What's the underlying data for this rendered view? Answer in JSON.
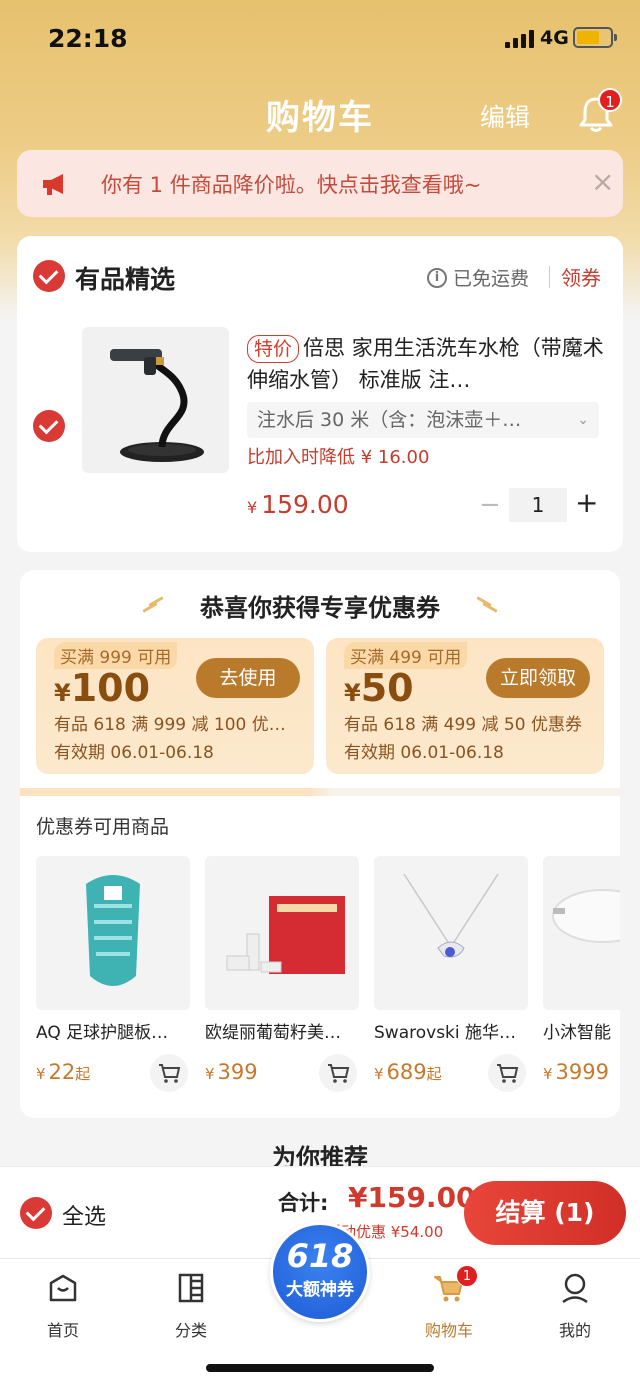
{
  "status_bar": {
    "time": "22:18",
    "network": "4G"
  },
  "header": {
    "title": "购物车",
    "edit_label": "编辑",
    "notification_count": "1"
  },
  "notice": {
    "text": "你有 1 件商品降价啦。快点击我查看哦~",
    "close": "×"
  },
  "shop": {
    "name": "有品精选",
    "shipping": "已免运费",
    "info_glyph": "i",
    "coupon_link": "领券",
    "item": {
      "tag": "特价",
      "title": "倍思 家用生活洗车水枪（带魔术伸缩水管） 标准版 注…",
      "spec": "注水后 30 米（含：泡沫壶＋…",
      "spec_arrow": "⌄",
      "price_drop": "比加入时降低 ¥ 16.00",
      "currency": "¥",
      "price": "159.00",
      "quantity": "1",
      "minus": "−",
      "plus": "+"
    }
  },
  "coupons": {
    "title": "恭喜你获得专享优惠券",
    "list": [
      {
        "condition": "买满 999 可用",
        "currency": "¥",
        "amount": "100",
        "button": "去使用",
        "desc": "有品 618 满 999 减 100 优…",
        "valid": "有效期 06.01-06.18"
      },
      {
        "condition": "买满 499 可用",
        "currency": "¥",
        "amount": "50",
        "button": "立即领取",
        "desc": "有品 618 满 499 减 50 优惠券",
        "valid": "有效期 06.01-06.18"
      }
    ],
    "available_title": "优惠券可用商品",
    "items": [
      {
        "name": "AQ 足球护腿板…",
        "currency": "¥",
        "price": "22",
        "suffix": "起"
      },
      {
        "name": "欧缇丽葡萄籽美…",
        "currency": "¥",
        "price": "399",
        "suffix": ""
      },
      {
        "name": "Swarovski 施华…",
        "currency": "¥",
        "price": "689",
        "suffix": "起"
      },
      {
        "name": "小沐智能",
        "currency": "¥",
        "price": "3999",
        "suffix": ""
      }
    ]
  },
  "recommend_title": "为你推荐",
  "checkout": {
    "select_all": "全选",
    "total_label": "合计:",
    "total": "¥159.00",
    "discount": "活动优惠 ¥54.00",
    "settle": "结算 (1)"
  },
  "promo": {
    "big": "618",
    "small": "大额神券"
  },
  "tabbar": {
    "tabs": [
      {
        "label": "首页"
      },
      {
        "label": "分类"
      },
      {
        "label": "购物车",
        "badge": "1"
      },
      {
        "label": "我的"
      }
    ]
  },
  "colors": {
    "accent_red": "#d93a35",
    "gold": "#b97a2c",
    "header_gold": "#e6c16e"
  }
}
